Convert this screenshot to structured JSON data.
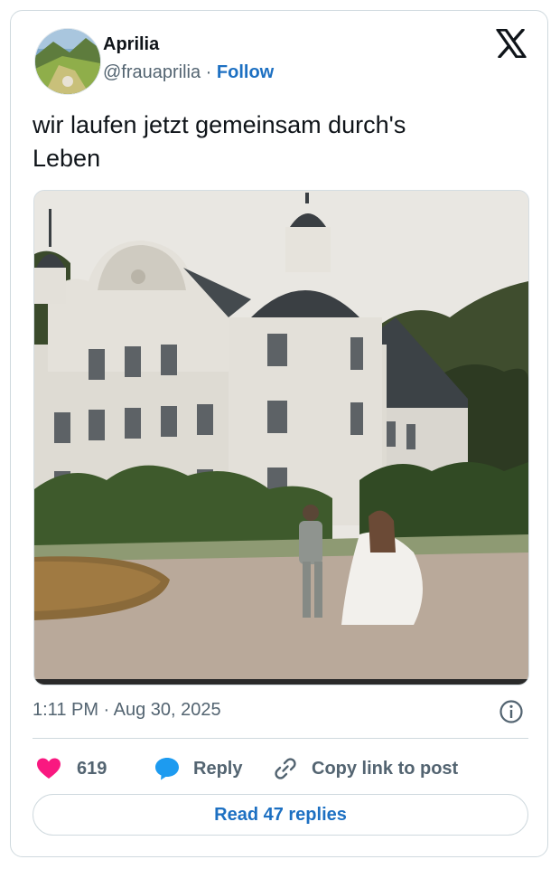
{
  "author": {
    "display_name": "Aprilia",
    "handle": "@frauaprilia",
    "separator": " · ",
    "follow_label": "Follow"
  },
  "tweet": {
    "text_line1": "wir laufen jetzt gemeinsam durch's",
    "text_line2": "Leben",
    "timestamp": "1:11 PM · Aug 30, 2025"
  },
  "actions": {
    "like_count": "619",
    "reply_label": "Reply",
    "copy_link_label": "Copy link to post"
  },
  "footer": {
    "read_replies_label": "Read 47 replies"
  },
  "icons": {
    "logo": "x-logo-icon",
    "like": "heart-icon",
    "reply": "speech-bubble-icon",
    "copy": "link-icon",
    "info": "info-icon"
  },
  "colors": {
    "like": "#f91880",
    "reply": "#1d9bf0",
    "link": "#1d70c2",
    "secondary_text": "#536471"
  }
}
